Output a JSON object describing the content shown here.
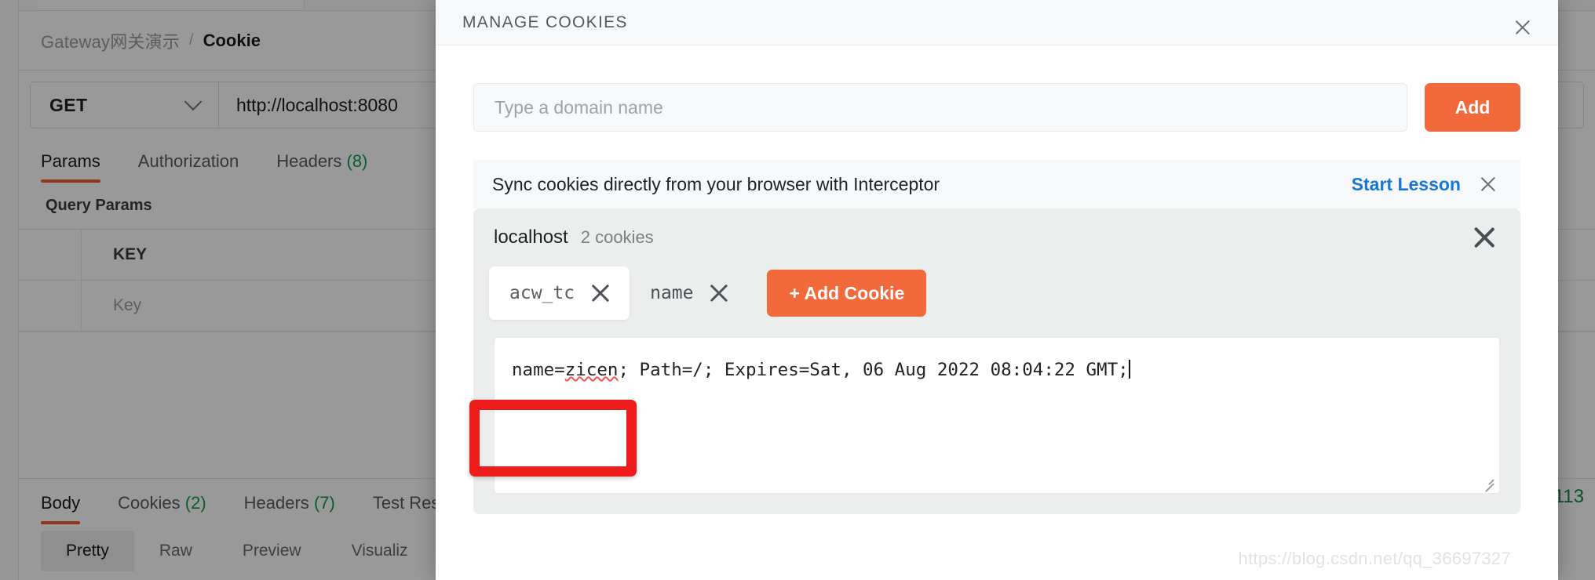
{
  "background": {
    "breadcrumb": {
      "root": "Gateway网关演示",
      "separator": "/",
      "leaf": "Cookie"
    },
    "request": {
      "method": "GET",
      "url": "http://localhost:8080",
      "tabs": [
        {
          "label": "Params",
          "count": "",
          "active": true
        },
        {
          "label": "Authorization",
          "count": "",
          "active": false
        },
        {
          "label": "Headers",
          "count": "(8)",
          "active": false
        }
      ],
      "section_title": "Query Params",
      "table_header_key": "KEY",
      "table_row_key_placeholder": "Key"
    },
    "response": {
      "tabs": [
        {
          "label": "Body",
          "count": "",
          "active": true
        },
        {
          "label": "Cookies",
          "count": "(2)",
          "active": false
        },
        {
          "label": "Headers",
          "count": "(7)",
          "active": false
        },
        {
          "label": "Test Res",
          "count": "",
          "active": false
        }
      ],
      "view_modes": [
        {
          "label": "Pretty",
          "active": true
        },
        {
          "label": "Raw",
          "active": false
        },
        {
          "label": "Preview",
          "active": false
        },
        {
          "label": "Visualiz",
          "active": false
        }
      ],
      "status_code": "113"
    }
  },
  "modal": {
    "title": "MANAGE COOKIES",
    "close_icon": "close-icon",
    "domain_field": {
      "value": "",
      "placeholder": "Type a domain name"
    },
    "add_button_label": "Add",
    "interceptor": {
      "message": "Sync cookies directly from your browser with Interceptor",
      "action_label": "Start Lesson",
      "close_icon": "close-icon"
    },
    "domain_card": {
      "host": "localhost",
      "cookie_count_label": "2 cookies",
      "close_icon": "close-icon",
      "cookies": [
        {
          "name": "acw_tc",
          "selected": true,
          "remove_icon": "close-icon"
        },
        {
          "name": "name",
          "selected": false,
          "remove_icon": "close-icon"
        }
      ],
      "add_cookie_label": "+ Add Cookie",
      "editor": {
        "full_value": "name=zicen; Path=/; Expires=Sat, 06 Aug 2022 08:04:22 GMT;",
        "prefix": "name=",
        "misspelled_word": "zicen",
        "suffix": "; Path=/; Expires=Sat, 06 Aug 2022 08:04:22 GMT;",
        "resize_handle_icon": "resize-handle-icon"
      }
    }
  },
  "watermark": "https://blog.csdn.net/qq_36697327",
  "colors": {
    "accent_orange": "#f2693c",
    "link_blue": "#1877d2",
    "count_green": "#0c9e4b",
    "annotation_red": "#ef1c1c",
    "modal_header_bg": "#f7f8fa",
    "card_bg": "#eceded"
  }
}
